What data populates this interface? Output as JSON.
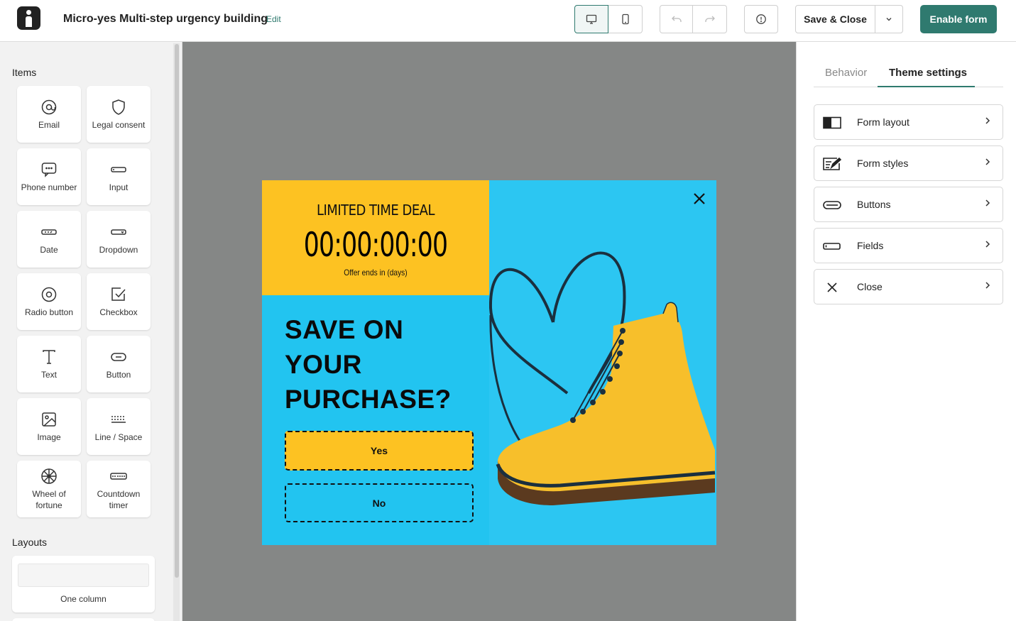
{
  "header": {
    "title": "Micro-yes Multi-step urgency building",
    "edit_label": "Edit",
    "save_close_label": "Save & Close",
    "enable_label": "Enable form"
  },
  "sidebar": {
    "items_title": "Items",
    "items": [
      {
        "label": "Email",
        "icon": "at-icon"
      },
      {
        "label": "Legal consent",
        "icon": "shield-icon"
      },
      {
        "label": "Phone number",
        "icon": "chat-icon"
      },
      {
        "label": "Input",
        "icon": "input-icon"
      },
      {
        "label": "Date",
        "icon": "date-icon"
      },
      {
        "label": "Dropdown",
        "icon": "dropdown-icon"
      },
      {
        "label": "Radio button",
        "icon": "radio-icon"
      },
      {
        "label": "Checkbox",
        "icon": "checkbox-icon"
      },
      {
        "label": "Text",
        "icon": "text-icon"
      },
      {
        "label": "Button",
        "icon": "button-icon"
      },
      {
        "label": "Image",
        "icon": "image-icon"
      },
      {
        "label": "Line / Space",
        "icon": "line-space-icon"
      },
      {
        "label": "Wheel of fortune",
        "icon": "wheel-icon"
      },
      {
        "label": "Countdown timer",
        "icon": "countdown-icon"
      }
    ],
    "layouts_title": "Layouts",
    "layouts": [
      {
        "label": "One column"
      }
    ]
  },
  "popup": {
    "deal_title": "LIMITED TIME DEAL",
    "timer": "00:00:00:00",
    "timer_caption": "Offer ends in (days)",
    "headline": "SAVE ON YOUR PURCHASE?",
    "yes_label": "Yes",
    "no_label": "No",
    "colors": {
      "yellow": "#fdc222",
      "blue": "#22c4f0"
    }
  },
  "right_panel": {
    "tabs": [
      {
        "label": "Behavior",
        "active": false
      },
      {
        "label": "Theme settings",
        "active": true
      }
    ],
    "options": [
      {
        "label": "Form layout",
        "icon": "form-layout-icon"
      },
      {
        "label": "Form styles",
        "icon": "form-styles-icon"
      },
      {
        "label": "Buttons",
        "icon": "buttons-icon"
      },
      {
        "label": "Fields",
        "icon": "fields-icon"
      },
      {
        "label": "Close",
        "icon": "close-icon"
      }
    ]
  },
  "accent_color": "#2f7a6f"
}
